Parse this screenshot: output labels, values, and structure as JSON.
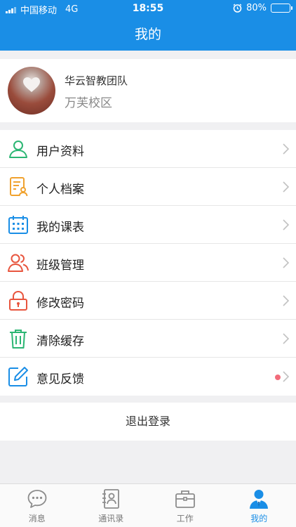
{
  "status_bar": {
    "carrier": "中国移动",
    "network": "4G",
    "time": "18:55",
    "battery": "80%",
    "battery_level": 0.8,
    "alarm_icon": "alarm-clock-icon"
  },
  "header": {
    "title": "我的"
  },
  "profile": {
    "name": "华云智教团队",
    "campus": "万芙校区"
  },
  "menu": {
    "items": [
      {
        "label": "用户资料",
        "icon": "user-profile-icon",
        "color": "#2bb673"
      },
      {
        "label": "个人档案",
        "icon": "personal-file-icon",
        "color": "#f0a22e"
      },
      {
        "label": "我的课表",
        "icon": "calendar-icon",
        "color": "#1a8ee6"
      },
      {
        "label": "班级管理",
        "icon": "group-users-icon",
        "color": "#e8553e"
      },
      {
        "label": "修改密码",
        "icon": "lock-icon",
        "color": "#e8553e"
      },
      {
        "label": "清除缓存",
        "icon": "trash-icon",
        "color": "#2bb673"
      },
      {
        "label": "意见反馈",
        "icon": "edit-feedback-icon",
        "color": "#1a8ee6",
        "badge": true
      }
    ]
  },
  "logout": {
    "label": "退出登录"
  },
  "tabbar": {
    "tabs": [
      {
        "label": "消息",
        "icon": "chat-bubble-icon"
      },
      {
        "label": "通讯录",
        "icon": "contacts-icon"
      },
      {
        "label": "工作",
        "icon": "briefcase-icon"
      },
      {
        "label": "我的",
        "icon": "person-icon",
        "active": true
      }
    ]
  },
  "colors": {
    "accent": "#1a8ee6",
    "badge": "#f26b7a"
  }
}
